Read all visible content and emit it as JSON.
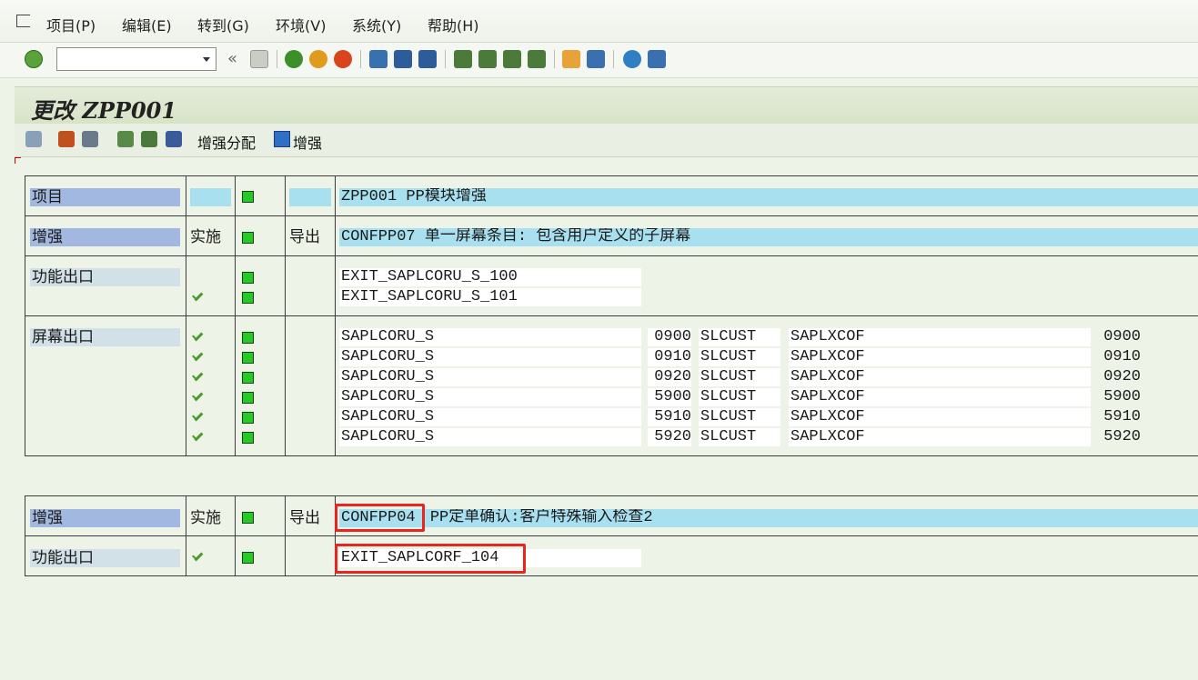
{
  "menu": {
    "items": [
      "项目(P)",
      "编辑(E)",
      "转到(G)",
      "环境(V)",
      "系统(Y)",
      "帮助(H)"
    ]
  },
  "toolbar": {
    "command_value": "",
    "back_glyph": "«"
  },
  "title": "更改 ZPP001",
  "app_toolbar": {
    "enh_assign_label": "增强分配",
    "enh_label": "增强"
  },
  "project_block": {
    "rows": {
      "project": {
        "label": "项目",
        "value": "ZPP001   PP模块增强"
      },
      "enhancement": {
        "label": "增强",
        "impl": "实施",
        "export": "导出",
        "value": "CONFPP07 单一屏幕条目: 包含用户定义的子屏幕"
      },
      "function_exits": {
        "label": "功能出口",
        "items": [
          "EXIT_SAPLCORU_S_100",
          "EXIT_SAPLCORU_S_101"
        ]
      },
      "screen_exits": {
        "label": "屏幕出口",
        "items": [
          {
            "program": "SAPLCORU_S",
            "screen": "0900",
            "area": "SLCUST",
            "called_program": "SAPLXCOF",
            "called_screen": "0900"
          },
          {
            "program": "SAPLCORU_S",
            "screen": "0910",
            "area": "SLCUST",
            "called_program": "SAPLXCOF",
            "called_screen": "0910"
          },
          {
            "program": "SAPLCORU_S",
            "screen": "0920",
            "area": "SLCUST",
            "called_program": "SAPLXCOF",
            "called_screen": "0920"
          },
          {
            "program": "SAPLCORU_S",
            "screen": "5900",
            "area": "SLCUST",
            "called_program": "SAPLXCOF",
            "called_screen": "5900"
          },
          {
            "program": "SAPLCORU_S",
            "screen": "5910",
            "area": "SLCUST",
            "called_program": "SAPLXCOF",
            "called_screen": "5910"
          },
          {
            "program": "SAPLCORU_S",
            "screen": "5920",
            "area": "SLCUST",
            "called_program": "SAPLXCOF",
            "called_screen": "5920"
          }
        ]
      }
    }
  },
  "second_block": {
    "enhancement": {
      "label": "增强",
      "impl": "实施",
      "export": "导出",
      "code": "CONFPP04",
      "desc": "PP定单确认:客户特殊输入检查2"
    },
    "function_exits": {
      "label": "功能出口",
      "items": [
        "EXIT_SAPLCORF_104"
      ]
    }
  },
  "colors": {
    "label_dark": "#a3b8e0",
    "label_light": "#d2e0e8",
    "cyan": "#a8e0f0",
    "status_green": "#28c828",
    "highlight_red": "#e8251f"
  }
}
